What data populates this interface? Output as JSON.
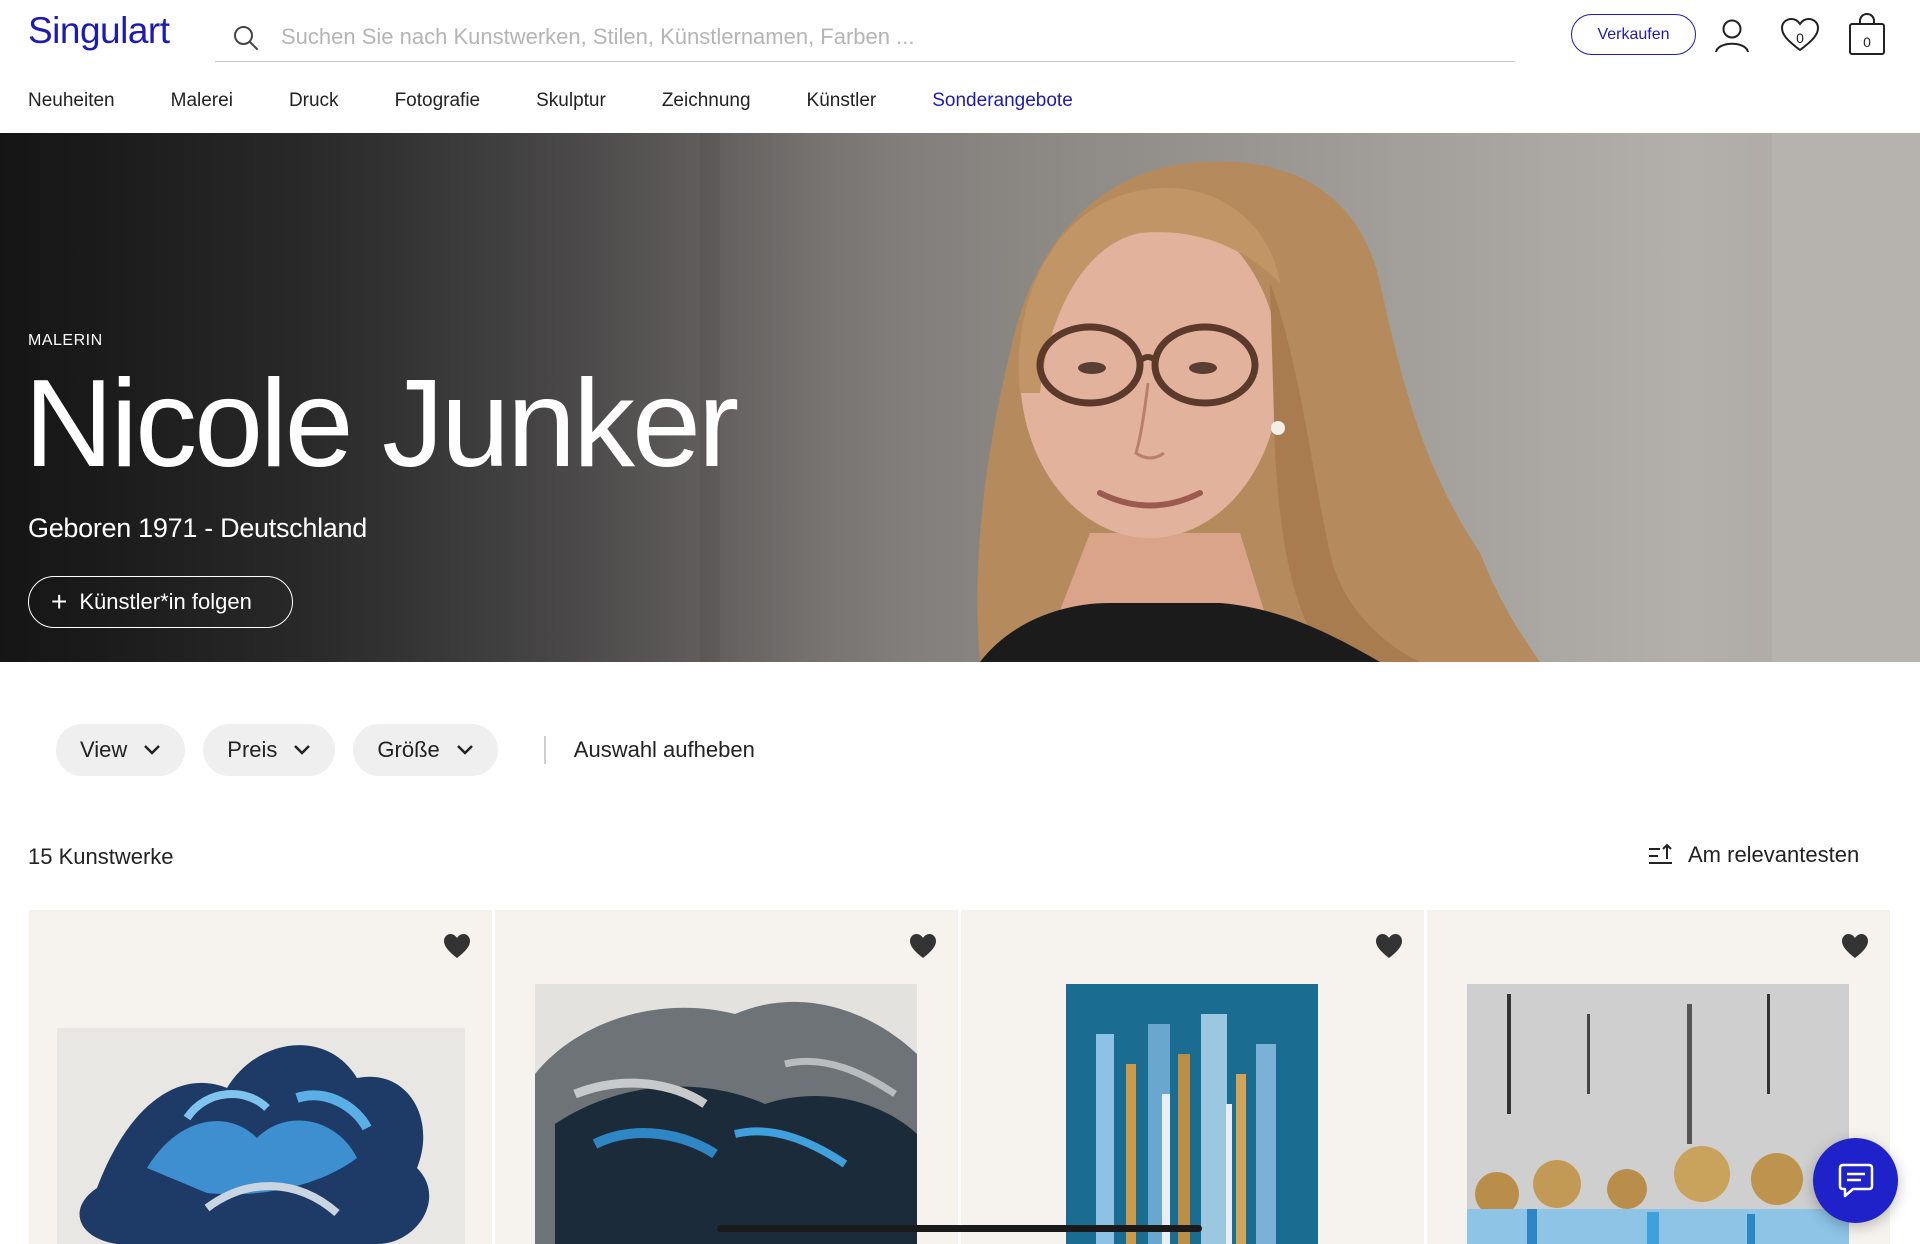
{
  "brand": {
    "logo": "Singulart",
    "accent": "#1e1bb0"
  },
  "search": {
    "placeholder": "Suchen Sie nach Kunstwerken, Stilen, Künstlernamen, Farben ..."
  },
  "header": {
    "sell_label": "Verkaufen",
    "favorites_count": "0",
    "cart_count": "0"
  },
  "nav": {
    "items": [
      {
        "label": "Neuheiten"
      },
      {
        "label": "Malerei"
      },
      {
        "label": "Druck"
      },
      {
        "label": "Fotografie"
      },
      {
        "label": "Skulptur"
      },
      {
        "label": "Zeichnung"
      },
      {
        "label": "Künstler"
      },
      {
        "label": "Sonderangebote"
      }
    ]
  },
  "artist": {
    "role": "MALERIN",
    "name": "Nicole Junker",
    "subtitle": "Geboren 1971 - Deutschland",
    "follow_label": "Künstler*in folgen"
  },
  "filters": {
    "items": [
      {
        "label": "View"
      },
      {
        "label": "Preis"
      },
      {
        "label": "Größe"
      }
    ],
    "clear_label": "Auswahl aufheben"
  },
  "results": {
    "count_label": "15 Kunstwerke",
    "sort_label": "Am relevantesten"
  },
  "artworks": [
    {
      "name": "artwork-1",
      "icon": "heart-icon"
    },
    {
      "name": "artwork-2",
      "icon": "heart-icon"
    },
    {
      "name": "artwork-3",
      "icon": "heart-icon"
    },
    {
      "name": "artwork-4",
      "icon": "heart-icon"
    }
  ]
}
